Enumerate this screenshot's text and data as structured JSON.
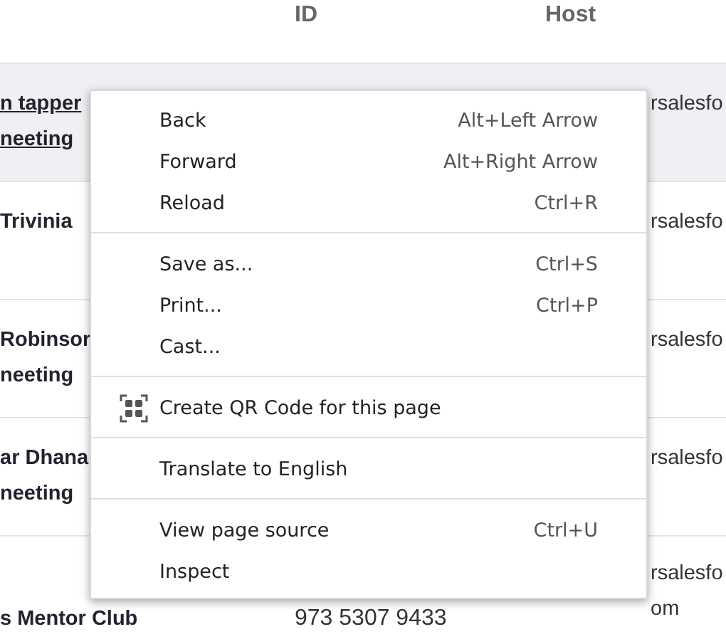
{
  "table": {
    "columns": [
      "ID",
      "Host"
    ],
    "rows": [
      {
        "name_lines": [
          "n tapper",
          "neeting"
        ],
        "id": "",
        "host_lines": [
          "rsalesfo"
        ],
        "hovered": true
      },
      {
        "name_lines": [
          "Trivinia"
        ],
        "id": "",
        "host_lines": [
          "rsalesfo"
        ],
        "hovered": false
      },
      {
        "name_lines": [
          "Robinsor",
          "neeting"
        ],
        "id": "",
        "host_lines": [
          "rsalesfo"
        ],
        "hovered": false
      },
      {
        "name_lines": [
          "ar Dhana",
          "neeting"
        ],
        "id": "",
        "host_lines": [
          "rsalesfo"
        ],
        "hovered": false
      },
      {
        "name_lines": [
          "s Mentor Club"
        ],
        "id": "973 5307 9433",
        "host_lines": [
          "rsalesfo",
          "om"
        ],
        "hovered": false
      }
    ]
  },
  "context_menu": {
    "groups": [
      [
        {
          "kind": "plain",
          "label": "Back",
          "shortcut": "Alt+Left Arrow"
        },
        {
          "kind": "plain",
          "label": "Forward",
          "shortcut": "Alt+Right Arrow"
        },
        {
          "kind": "plain",
          "label": "Reload",
          "shortcut": "Ctrl+R"
        }
      ],
      [
        {
          "kind": "plain",
          "label": "Save as...",
          "shortcut": "Ctrl+S"
        },
        {
          "kind": "plain",
          "label": "Print...",
          "shortcut": "Ctrl+P"
        },
        {
          "kind": "plain",
          "label": "Cast..."
        }
      ],
      [
        {
          "kind": "qr",
          "label": "Create QR Code for this page"
        }
      ],
      [
        {
          "kind": "plain",
          "label": "Translate to English"
        }
      ],
      [
        {
          "kind": "plain",
          "label": "View page source",
          "shortcut": "Ctrl+U"
        },
        {
          "kind": "plain",
          "label": "Inspect"
        }
      ]
    ]
  }
}
